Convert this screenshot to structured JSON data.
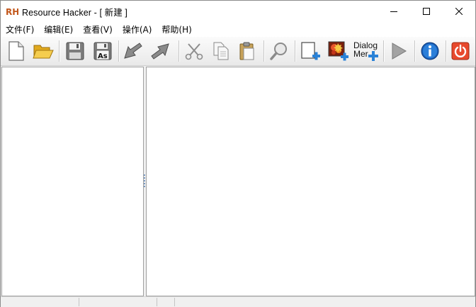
{
  "window": {
    "title": "Resource Hacker - [ 新建 ]",
    "logo_text": "RH",
    "controls": {
      "minimize": "minimize",
      "maximize": "maximize",
      "close": "close"
    }
  },
  "menu": [
    {
      "label": "文件(F)"
    },
    {
      "label": "编辑(E)"
    },
    {
      "label": "查看(V)"
    },
    {
      "label": "操作(A)"
    },
    {
      "label": "帮助(H)"
    }
  ],
  "toolbar": {
    "dialog_menu_label": "Dialog\nMer",
    "buttons": [
      {
        "icon": "new-file-icon"
      },
      {
        "icon": "open-folder-icon"
      },
      {
        "icon": "save-icon"
      },
      {
        "icon": "save-as-icon",
        "badge": "As"
      },
      {
        "icon": "back-arrow-icon"
      },
      {
        "icon": "forward-arrow-icon"
      },
      {
        "icon": "cut-icon"
      },
      {
        "icon": "copy-icon"
      },
      {
        "icon": "paste-icon"
      },
      {
        "icon": "find-icon"
      },
      {
        "icon": "add-blank-resource-icon"
      },
      {
        "icon": "add-image-resource-icon"
      },
      {
        "icon": "dialog-merger-icon"
      },
      {
        "icon": "run-script-icon"
      },
      {
        "icon": "about-icon"
      },
      {
        "icon": "exit-icon"
      }
    ]
  },
  "colors": {
    "accent_blue": "#1b73c8",
    "power_red": "#e8492d",
    "folder_yellow": "#f2c23a"
  }
}
